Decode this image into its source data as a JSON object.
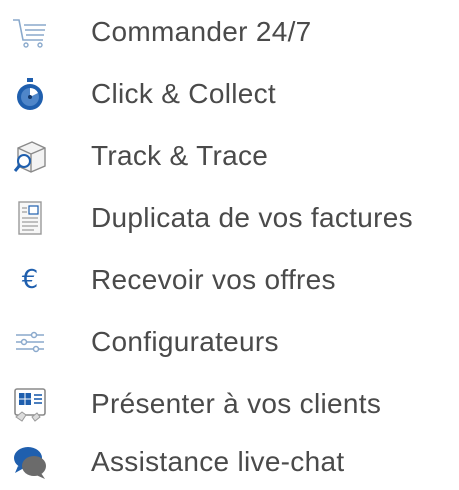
{
  "menu": {
    "items": [
      {
        "label": "Commander 24/7",
        "icon": "shopping-cart-icon"
      },
      {
        "label": "Click & Collect",
        "icon": "stopwatch-icon"
      },
      {
        "label": "Track & Trace",
        "icon": "package-search-icon"
      },
      {
        "label": "Duplicata de vos factures",
        "icon": "invoice-icon"
      },
      {
        "label": "Recevoir vos offres",
        "icon": "euro-icon",
        "glyph": "€"
      },
      {
        "label": "Configurateurs",
        "icon": "sliders-icon"
      },
      {
        "label": "Présenter à vos clients",
        "icon": "presentation-icon"
      },
      {
        "label": "Assistance live-chat",
        "icon": "chat-bubbles-icon"
      }
    ]
  },
  "colors": {
    "text": "#4a4a4a",
    "accent": "#1f5fae",
    "icon_gray": "#8a8a8a"
  }
}
